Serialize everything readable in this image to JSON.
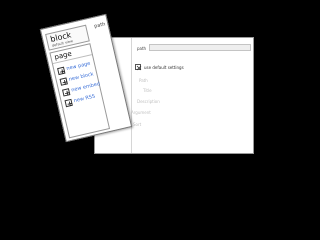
{
  "settings": {
    "path_label": "path",
    "path_value": "",
    "use_default_label": "use default settings",
    "use_default_checked": true,
    "faded_fields": [
      "Path",
      "Title",
      "Description",
      "Argument",
      "Sort"
    ]
  },
  "panel": {
    "paths_tab": "path",
    "block_title": "block",
    "block_subtitle": "default view",
    "page_title": "page",
    "actions": [
      {
        "label": "new page"
      },
      {
        "label": "new block"
      },
      {
        "label": "new embed"
      },
      {
        "label": "new RSS"
      }
    ],
    "colors": {
      "link": "#3a6fd8",
      "border": "#777777"
    }
  }
}
